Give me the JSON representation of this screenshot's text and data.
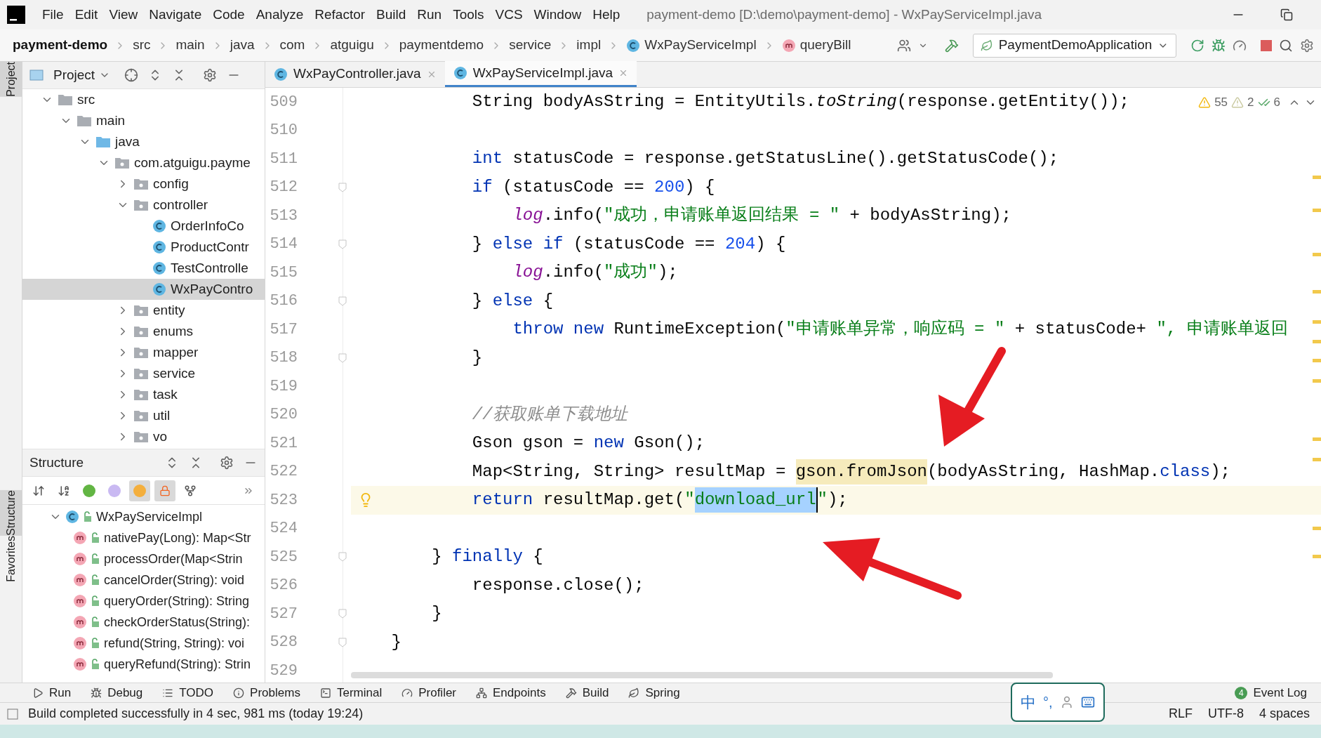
{
  "menu": [
    "File",
    "Edit",
    "View",
    "Navigate",
    "Code",
    "Analyze",
    "Refactor",
    "Build",
    "Run",
    "Tools",
    "VCS",
    "Window",
    "Help"
  ],
  "window_title": "payment-demo [D:\\demo\\payment-demo] - WxPayServiceImpl.java",
  "breadcrumbs": [
    {
      "label": "payment-demo",
      "kind": "project"
    },
    {
      "label": "src",
      "kind": "folder"
    },
    {
      "label": "main",
      "kind": "folder"
    },
    {
      "label": "java",
      "kind": "folder"
    },
    {
      "label": "com",
      "kind": "folder"
    },
    {
      "label": "atguigu",
      "kind": "folder"
    },
    {
      "label": "paymentdemo",
      "kind": "folder"
    },
    {
      "label": "service",
      "kind": "folder"
    },
    {
      "label": "impl",
      "kind": "folder"
    },
    {
      "label": "WxPayServiceImpl",
      "kind": "class"
    },
    {
      "label": "queryBill",
      "kind": "method"
    }
  ],
  "run_config": "PaymentDemoApplication",
  "side_tabs": [
    {
      "label": "Project",
      "selected": true
    },
    {
      "label": "Structure",
      "selected": true
    },
    {
      "label": "Favorites",
      "selected": false
    }
  ],
  "project_panel": {
    "title": "Project",
    "tree": [
      {
        "label": "src",
        "kind": "folder",
        "expanded": true,
        "selected": false,
        "children": [
          {
            "label": "main",
            "kind": "folder",
            "expanded": true,
            "selected": false,
            "children": [
              {
                "label": "java",
                "kind": "source",
                "expanded": true,
                "selected": false,
                "children": [
                  {
                    "label": "com.atguigu.payme",
                    "kind": "package",
                    "expanded": true,
                    "selected": false,
                    "children": [
                      {
                        "label": "config",
                        "kind": "package",
                        "expanded": false,
                        "selected": false
                      },
                      {
                        "label": "controller",
                        "kind": "package",
                        "expanded": true,
                        "selected": false,
                        "children": [
                          {
                            "label": "OrderInfoCo",
                            "kind": "class",
                            "selected": false
                          },
                          {
                            "label": "ProductContr",
                            "kind": "class",
                            "selected": false
                          },
                          {
                            "label": "TestControlle",
                            "kind": "class",
                            "selected": false
                          },
                          {
                            "label": "WxPayContro",
                            "kind": "class",
                            "selected": true
                          }
                        ]
                      },
                      {
                        "label": "entity",
                        "kind": "package",
                        "expanded": false,
                        "selected": false
                      },
                      {
                        "label": "enums",
                        "kind": "package",
                        "expanded": false,
                        "selected": false
                      },
                      {
                        "label": "mapper",
                        "kind": "package",
                        "expanded": false,
                        "selected": false
                      },
                      {
                        "label": "service",
                        "kind": "package",
                        "expanded": false,
                        "selected": false
                      },
                      {
                        "label": "task",
                        "kind": "package",
                        "expanded": false,
                        "selected": false
                      },
                      {
                        "label": "util",
                        "kind": "package",
                        "expanded": false,
                        "selected": false
                      },
                      {
                        "label": "vo",
                        "kind": "package",
                        "expanded": false,
                        "selected": false
                      }
                    ]
                  }
                ]
              }
            ]
          }
        ]
      }
    ]
  },
  "structure_panel": {
    "title": "Structure",
    "toggles": [
      {
        "kind": "sort-visibility",
        "selected": false
      },
      {
        "kind": "sort-alpha",
        "selected": false
      },
      {
        "kind": "inherited",
        "selected": false
      },
      {
        "kind": "properties",
        "selected": false
      },
      {
        "kind": "fields",
        "selected": true
      },
      {
        "kind": "non-public",
        "selected": true
      },
      {
        "kind": "lambdas",
        "selected": false
      },
      {
        "kind": "more",
        "selected": false
      }
    ],
    "tree": [
      {
        "label": "WxPayServiceImpl",
        "kind": "class",
        "expanded": true,
        "children": [
          {
            "label": "nativePay(Long): Map<Str",
            "kind": "method"
          },
          {
            "label": "processOrder(Map<Strin",
            "kind": "method"
          },
          {
            "label": "cancelOrder(String): void",
            "kind": "method"
          },
          {
            "label": "queryOrder(String): String",
            "kind": "method"
          },
          {
            "label": "checkOrderStatus(String):",
            "kind": "method"
          },
          {
            "label": "refund(String, String): voi",
            "kind": "method"
          },
          {
            "label": "queryRefund(String): Strin",
            "kind": "method"
          }
        ]
      }
    ]
  },
  "editor_tabs": [
    {
      "label": "WxPayController.java",
      "selected": false
    },
    {
      "label": "WxPayServiceImpl.java",
      "selected": true
    }
  ],
  "inspections": {
    "warnings": "55",
    "weak_warnings": "2",
    "typos": "6"
  },
  "code_lines": [
    {
      "number": "509",
      "fold": false,
      "current": false,
      "tokens": [
        {
          "t": "            String bodyAsString = EntityUtils.",
          "kind": "plain"
        },
        {
          "t": "toString",
          "kind": "static"
        },
        {
          "t": "(response.getEntity());",
          "kind": "plain"
        }
      ]
    },
    {
      "number": "510",
      "fold": false,
      "current": false
    },
    {
      "number": "511",
      "fold": false,
      "current": false,
      "tokens": [
        {
          "t": "            int",
          "kind": "keyword"
        },
        {
          "t": " statusCode = response.getStatusLine().getStatusCode();",
          "kind": "plain"
        }
      ]
    },
    {
      "number": "512",
      "fold": true,
      "current": false,
      "tokens": [
        {
          "t": "            if",
          "kind": "keyword"
        },
        {
          "t": " (statusCode == ",
          "kind": "plain"
        },
        {
          "t": "200",
          "kind": "number"
        },
        {
          "t": ") {",
          "kind": "plain"
        }
      ]
    },
    {
      "number": "513",
      "fold": false,
      "current": false,
      "tokens": [
        {
          "t": "                log",
          "kind": "logger"
        },
        {
          "t": ".info(",
          "kind": "plain"
        },
        {
          "t": "\"成功，申请账单返回结果 = \"",
          "kind": "string"
        },
        {
          "t": " + bodyAsString);",
          "kind": "plain"
        }
      ]
    },
    {
      "number": "514",
      "fold": true,
      "current": false,
      "tokens": [
        {
          "t": "            } ",
          "kind": "plain"
        },
        {
          "t": "else if",
          "kind": "keyword"
        },
        {
          "t": " (statusCode == ",
          "kind": "plain"
        },
        {
          "t": "204",
          "kind": "number"
        },
        {
          "t": ") {",
          "kind": "plain"
        }
      ]
    },
    {
      "number": "515",
      "fold": false,
      "current": false,
      "tokens": [
        {
          "t": "                log",
          "kind": "logger"
        },
        {
          "t": ".info(",
          "kind": "plain"
        },
        {
          "t": "\"成功\"",
          "kind": "string"
        },
        {
          "t": ");",
          "kind": "plain"
        }
      ]
    },
    {
      "number": "516",
      "fold": true,
      "current": false,
      "tokens": [
        {
          "t": "            } ",
          "kind": "plain"
        },
        {
          "t": "else",
          "kind": "keyword"
        },
        {
          "t": " {",
          "kind": "plain"
        }
      ]
    },
    {
      "number": "517",
      "fold": false,
      "current": false,
      "tokens": [
        {
          "t": "                throw new",
          "kind": "keyword"
        },
        {
          "t": " RuntimeException(",
          "kind": "plain"
        },
        {
          "t": "\"申请账单异常，响应码 = \"",
          "kind": "string"
        },
        {
          "t": " + statusCode+ ",
          "kind": "plain"
        },
        {
          "t": "\", 申请账单返回",
          "kind": "string"
        }
      ]
    },
    {
      "number": "518",
      "fold": true,
      "current": false,
      "tokens": [
        {
          "t": "            }",
          "kind": "plain"
        }
      ]
    },
    {
      "number": "519",
      "fold": false,
      "current": false
    },
    {
      "number": "520",
      "fold": false,
      "current": false,
      "tokens": [
        {
          "t": "            //获取账单下载地址",
          "kind": "comment"
        }
      ]
    },
    {
      "number": "521",
      "fold": false,
      "current": false,
      "tokens": [
        {
          "t": "            Gson gson = ",
          "kind": "plain"
        },
        {
          "t": "new",
          "kind": "keyword"
        },
        {
          "t": " Gson();",
          "kind": "plain"
        }
      ]
    },
    {
      "number": "522",
      "fold": false,
      "current": false,
      "tokens": [
        {
          "t": "            Map<String, String> resultMap = ",
          "kind": "plain"
        },
        {
          "t": "gson.fromJson",
          "kind": "warning"
        },
        {
          "t": "(bodyAsString, HashMap.",
          "kind": "plain"
        },
        {
          "t": "class",
          "kind": "keyword"
        },
        {
          "t": ");",
          "kind": "plain"
        }
      ]
    },
    {
      "number": "523",
      "fold": false,
      "current": true,
      "tokens": [
        {
          "t": "            return",
          "kind": "keyword"
        },
        {
          "t": " resultMap.get(",
          "kind": "plain"
        },
        {
          "t": "\"",
          "kind": "string"
        },
        {
          "t": "download_url",
          "kind": "selected"
        },
        {
          "t": "\"",
          "kind": "string"
        },
        {
          "t": ");",
          "kind": "plain"
        }
      ]
    },
    {
      "number": "524",
      "fold": false,
      "current": false
    },
    {
      "number": "525",
      "fold": true,
      "current": false,
      "tokens": [
        {
          "t": "        } ",
          "kind": "plain"
        },
        {
          "t": "finally",
          "kind": "keyword"
        },
        {
          "t": " {",
          "kind": "plain"
        }
      ]
    },
    {
      "number": "526",
      "fold": false,
      "current": false,
      "tokens": [
        {
          "t": "            response.close();",
          "kind": "plain"
        }
      ]
    },
    {
      "number": "527",
      "fold": true,
      "current": false,
      "tokens": [
        {
          "t": "        }",
          "kind": "plain"
        }
      ]
    },
    {
      "number": "528",
      "fold": true,
      "current": false,
      "tokens": [
        {
          "t": "    }",
          "kind": "plain"
        }
      ]
    },
    {
      "number": "529",
      "fold": false,
      "current": false
    }
  ],
  "tool_windows": [
    {
      "label": "Run",
      "kind": "run"
    },
    {
      "label": "Debug",
      "kind": "debug"
    },
    {
      "label": "TODO",
      "kind": "todo"
    },
    {
      "label": "Problems",
      "kind": "problems"
    },
    {
      "label": "Terminal",
      "kind": "terminal"
    },
    {
      "label": "Profiler",
      "kind": "profiler"
    },
    {
      "label": "Endpoints",
      "kind": "endpoints"
    },
    {
      "label": "Build",
      "kind": "build"
    },
    {
      "label": "Spring",
      "kind": "spring"
    }
  ],
  "event_log": {
    "label": "Event Log",
    "count": "4"
  },
  "ime": {
    "mode": "中",
    "punctuation": "°,"
  },
  "status": {
    "message": "Build completed successfully in 4 sec, 981 ms (today 19:24)",
    "items": [
      "RLF",
      "UTF-8",
      "4 spaces"
    ]
  }
}
